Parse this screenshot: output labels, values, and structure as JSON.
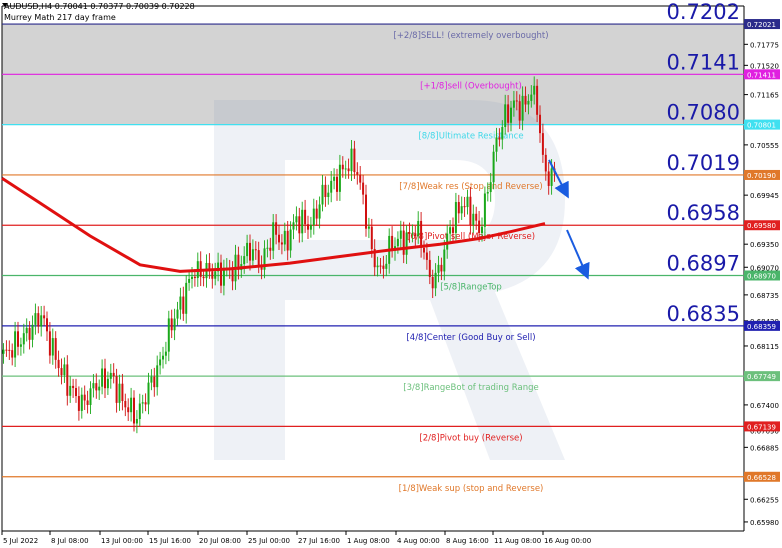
{
  "header": {
    "symbol_line": "AUDUSD,H4  0.70041 0.70377 0.70039 0.70228",
    "indicator_line": "Murrey Math 217 day frame"
  },
  "chart_data": {
    "type": "candlestick",
    "symbol": "AUDUSD",
    "timeframe": "H4",
    "indicator": "Murrey Math 217 day frame",
    "ohlc_header": {
      "open": 0.70041,
      "high": 0.70377,
      "low": 0.70039,
      "close": 0.70228
    },
    "ylim": [
      0.6587,
      0.7224
    ],
    "y_ticks": [
      "0.72025",
      "0.71775",
      "0.71520",
      "0.71165",
      "0.70805",
      "0.70555",
      "0.70195",
      "0.69945",
      "0.69580",
      "0.69350",
      "0.69070",
      "0.68735",
      "0.68420",
      "0.68115",
      "0.67745",
      "0.67400",
      "0.67090",
      "0.66885",
      "0.66525",
      "0.66255",
      "0.65980"
    ],
    "x_ticks": [
      "5 Jul 2022",
      "8 Jul 08:00",
      "13 Jul 00:00",
      "15 Jul 16:00",
      "20 Jul 08:00",
      "25 Jul 00:00",
      "27 Jul 16:00",
      "1 Aug 08:00",
      "4 Aug 00:00",
      "8 Aug 16:00",
      "11 Aug 08:00",
      "16 Aug 00:00"
    ],
    "levels": [
      {
        "label": "[+2/8]SELL! (extremely overbought)",
        "value": 0.72021,
        "tag": "0.72021",
        "big_label": "0.7202",
        "color": "#2a2a8a",
        "text_color": "#6a6aa8"
      },
      {
        "label": "[+1/8]sell (Overbought)",
        "value": 0.71411,
        "tag": "0.71411",
        "big_label": "0.7141",
        "color": "#e020e0",
        "text_color": "#e020e0"
      },
      {
        "label": "[8/8]Ultimate Resistance",
        "value": 0.70801,
        "tag": "0.70801",
        "big_label": "0.7080",
        "color": "#40e0f0",
        "text_color": "#40d8e8"
      },
      {
        "label": "[7/8]Weak res (Stop and Reverse)",
        "value": 0.7019,
        "tag": "0.70190",
        "big_label": "0.7019",
        "color": "#e0782a",
        "text_color": "#e0782a"
      },
      {
        "label": "[6/8]Pivot sell (Major Reverse)",
        "value": 0.6958,
        "tag": "0.69580",
        "big_label": "0.6958",
        "color": "#e02020",
        "text_color": "#e02020"
      },
      {
        "label": "[5/8]RangeTop",
        "value": 0.6897,
        "tag": "0.68970",
        "big_label": "0.6897",
        "color": "#4ab56a",
        "text_color": "#4ab56a"
      },
      {
        "label": "[4/8]Center (Good Buy or Sell)",
        "value": 0.68359,
        "tag": "0.68359",
        "big_label": "0.6835",
        "color": "#2020b0",
        "text_color": "#2020b0"
      },
      {
        "label": "[3/8]RangeBot of trading Range",
        "value": 0.67749,
        "tag": "0.67749",
        "big_label": "",
        "color": "#6cc07c",
        "text_color": "#6cc07c"
      },
      {
        "label": "[2/8]Pivot buy (Reverse)",
        "value": 0.67139,
        "tag": "0.67139",
        "big_label": "",
        "color": "#e02020",
        "text_color": "#e02020"
      },
      {
        "label": "[1/8]Weak sup (stop and Reverse)",
        "value": 0.66528,
        "tag": "0.66528",
        "big_label": "",
        "color": "#e0782a",
        "text_color": "#e0782a"
      }
    ],
    "ma_color": "#e01010",
    "arrow_color": "#1a5ce0",
    "overbought_zone_color": "#d3d3d3"
  }
}
